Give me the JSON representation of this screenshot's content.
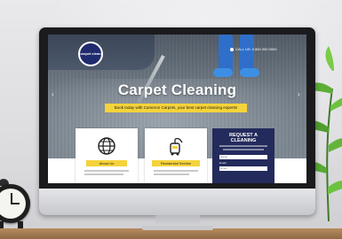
{
  "scene": {
    "colors": {
      "monitor_bezel": "#1b1b1d",
      "accent_yellow": "#f5d33a",
      "navy": "#232b5c",
      "blue": "#2f6fc9"
    }
  },
  "website": {
    "logo_text": "carpet clean",
    "phone": "CALL US: 0 800 000 0000",
    "hero": {
      "title": "Carpet Cleaning",
      "tagline": "Book today with Cameron Carpets, your best carpet cleaning experts!"
    },
    "cards": [
      {
        "label": "About Us",
        "icon": "globe-icon"
      },
      {
        "label": "Residential Service",
        "icon": "vacuum-icon"
      }
    ],
    "request": {
      "title_line1": "REQUEST A",
      "title_line2": "CLEANING",
      "email_label": "Email",
      "name_placeholder": "Name",
      "email_placeholder": "Email"
    }
  }
}
